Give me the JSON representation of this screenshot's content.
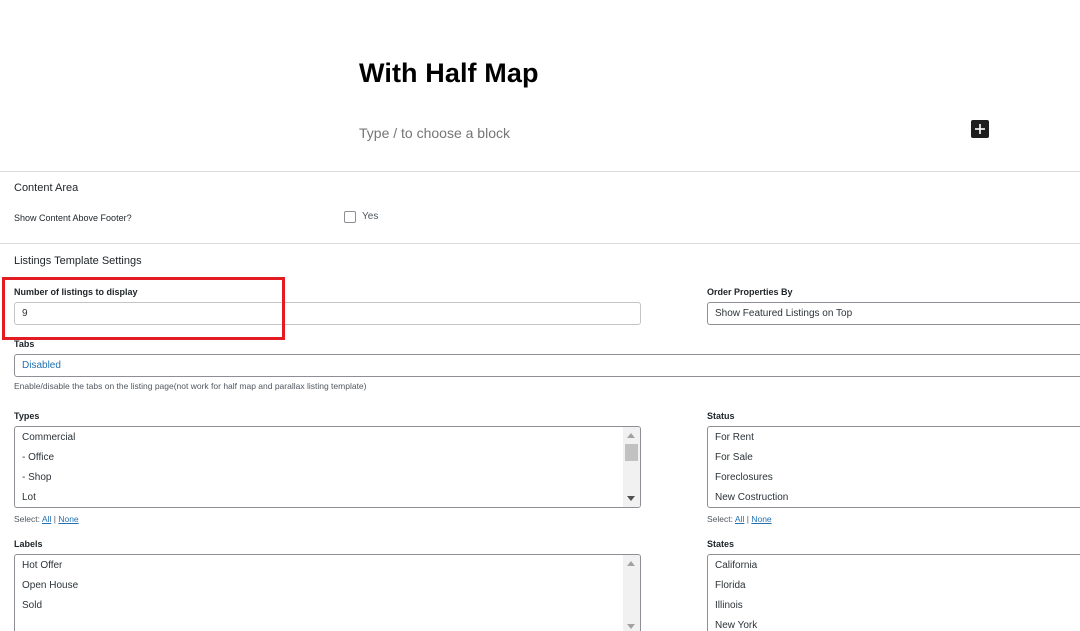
{
  "editor": {
    "title": "With Half Map",
    "block_placeholder": "Type / to choose a block"
  },
  "content_area": {
    "heading": "Content Area",
    "show_content_label": "Show Content Above Footer?",
    "checkbox_label": "Yes",
    "checked": false
  },
  "listings": {
    "heading": "Listings Template Settings",
    "number_label": "Number of listings to display",
    "number_value": "9",
    "order_label": "Order Properties By",
    "order_value": "Show Featured Listings on Top",
    "tabs_label": "Tabs",
    "tabs_value": "Disabled",
    "tabs_hint": "Enable/disable the tabs on the listing page(not work for half map and parallax listing template)",
    "types_label": "Types",
    "types_options": [
      "Commercial",
      "- Office",
      "- Shop",
      "Lot"
    ],
    "status_label": "Status",
    "status_options": [
      "For Rent",
      "For Sale",
      "Foreclosures",
      "New Costruction"
    ],
    "labels_label": "Labels",
    "labels_options": [
      "Hot Offer",
      "Open House",
      "Sold"
    ],
    "states_label": "States",
    "states_options": [
      "California",
      "Florida",
      "Illinois",
      "New York"
    ],
    "select_prefix": "Select:",
    "select_all": "All",
    "select_none": "None",
    "separator": "|"
  },
  "colors": {
    "link": "#2271b1",
    "highlight": "#e31b23"
  }
}
